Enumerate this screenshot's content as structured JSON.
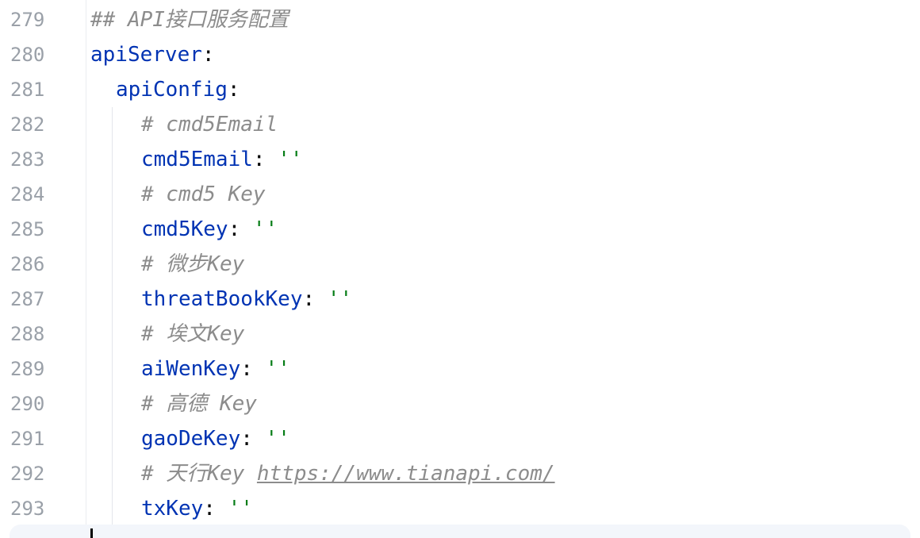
{
  "editor": {
    "lines": [
      {
        "number": "279",
        "comment": "## API接口服务配置"
      },
      {
        "number": "280",
        "key": "apiServer",
        "colon": ":"
      },
      {
        "number": "281",
        "key": "apiConfig",
        "colon": ":"
      },
      {
        "number": "282",
        "comment": "# cmd5Email"
      },
      {
        "number": "283",
        "key": "cmd5Email",
        "colon": ":",
        "value": "''"
      },
      {
        "number": "284",
        "comment": "# cmd5 Key"
      },
      {
        "number": "285",
        "key": "cmd5Key",
        "colon": ":",
        "value": "''"
      },
      {
        "number": "286",
        "comment": "# 微步Key"
      },
      {
        "number": "287",
        "key": "threatBookKey",
        "colon": ":",
        "value": "''"
      },
      {
        "number": "288",
        "comment": "# 埃文Key"
      },
      {
        "number": "289",
        "key": "aiWenKey",
        "colon": ":",
        "value": "''"
      },
      {
        "number": "290",
        "comment": "# 高德 Key"
      },
      {
        "number": "291",
        "key": "gaoDeKey",
        "colon": ":",
        "value": "''"
      },
      {
        "number": "292",
        "comment": "# 天行Key ",
        "link": "https://www.tianapi.com/"
      },
      {
        "number": "293",
        "key": "txKey",
        "colon": ":",
        "value": "''"
      }
    ]
  },
  "colors": {
    "key": "#0033b3",
    "string": "#067d17",
    "comment": "#8c8c8c",
    "line_number": "#9aa0a8"
  }
}
